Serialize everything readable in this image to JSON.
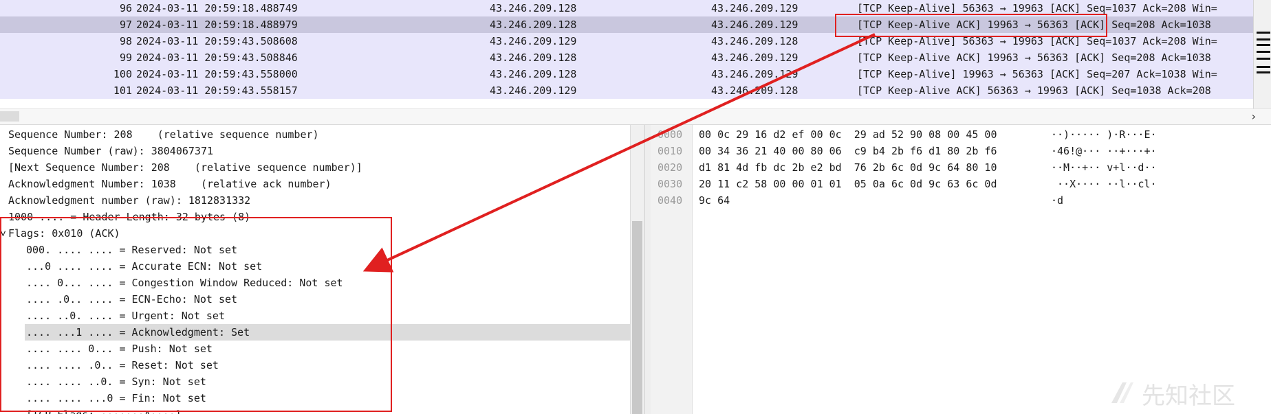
{
  "packet_list": {
    "rows": [
      {
        "no": "96",
        "time": "2024-03-11 20:59:18.488749",
        "src": "43.246.209.128",
        "dst": "43.246.209.129",
        "info": "[TCP Keep-Alive] 56363 → 19963 [ACK] Seq=1037 Ack=208 Win=",
        "selected": false
      },
      {
        "no": "97",
        "time": "2024-03-11 20:59:18.488979",
        "src": "43.246.209.128",
        "dst": "43.246.209.129",
        "info": "[TCP Keep-Alive ACK] 19963 → 56363 [ACK] Seq=208 Ack=1038",
        "selected": true
      },
      {
        "no": "98",
        "time": "2024-03-11 20:59:43.508608",
        "src": "43.246.209.129",
        "dst": "43.246.209.128",
        "info": "[TCP Keep-Alive] 56363 → 19963 [ACK] Seq=1037 Ack=208 Win=",
        "selected": false
      },
      {
        "no": "99",
        "time": "2024-03-11 20:59:43.508846",
        "src": "43.246.209.128",
        "dst": "43.246.209.129",
        "info": "[TCP Keep-Alive ACK] 19963 → 56363 [ACK] Seq=208 Ack=1038",
        "selected": false
      },
      {
        "no": "100",
        "time": "2024-03-11 20:59:43.558000",
        "src": "43.246.209.128",
        "dst": "43.246.209.129",
        "info": "[TCP Keep-Alive] 19963 → 56363 [ACK] Seq=207 Ack=1038 Win=",
        "selected": false
      },
      {
        "no": "101",
        "time": "2024-03-11 20:59:43.558157",
        "src": "43.246.209.129",
        "dst": "43.246.209.128",
        "info": "[TCP Keep-Alive ACK] 56363 → 19963 [ACK] Seq=1038 Ack=208",
        "selected": false
      }
    ],
    "scroll_right_arrow": "›"
  },
  "details": {
    "lines": [
      {
        "indent": 0,
        "text": "Sequence Number: 208    (relative sequence number)"
      },
      {
        "indent": 0,
        "text": "Sequence Number (raw): 3804067371"
      },
      {
        "indent": 0,
        "text": "[Next Sequence Number: 208    (relative sequence number)]"
      },
      {
        "indent": 0,
        "text": "Acknowledgment Number: 1038    (relative ack number)"
      },
      {
        "indent": 0,
        "text": "Acknowledgment number (raw): 1812831332"
      },
      {
        "indent": 0,
        "text": "1000 .... = Header Length: 32 bytes (8)"
      },
      {
        "indent": 0,
        "text": "Flags: 0x010 (ACK)",
        "expander": "˅"
      },
      {
        "indent": 1,
        "text": "000. .... .... = Reserved: Not set"
      },
      {
        "indent": 1,
        "text": "...0 .... .... = Accurate ECN: Not set"
      },
      {
        "indent": 1,
        "text": ".... 0... .... = Congestion Window Reduced: Not set"
      },
      {
        "indent": 1,
        "text": ".... .0.. .... = ECN-Echo: Not set"
      },
      {
        "indent": 1,
        "text": ".... ..0. .... = Urgent: Not set"
      },
      {
        "indent": 1,
        "text": ".... ...1 .... = Acknowledgment: Set",
        "highlight": true
      },
      {
        "indent": 1,
        "text": ".... .... 0... = Push: Not set"
      },
      {
        "indent": 1,
        "text": ".... .... .0.. = Reset: Not set"
      },
      {
        "indent": 1,
        "text": ".... .... ..0. = Syn: Not set"
      },
      {
        "indent": 1,
        "text": ".... .... ...0 = Fin: Not set"
      },
      {
        "indent": 1,
        "text": "[TCP Flags: ·······A····]"
      }
    ]
  },
  "bytes": {
    "rows": [
      {
        "offset": "0000",
        "hex": "00 0c 29 16 d2 ef 00 0c  29 ad 52 90 08 00 45 00",
        "ascii": "··)····· )·R···E·"
      },
      {
        "offset": "0010",
        "hex": "00 34 36 21 40 00 80 06  c9 b4 2b f6 d1 80 2b f6",
        "ascii": "·46!@··· ··+···+·"
      },
      {
        "offset": "0020",
        "hex": "d1 81 4d fb dc 2b e2 bd  76 2b 6c 0d 9c 64 80 10",
        "ascii": "··M··+·· v+l··d··"
      },
      {
        "offset": "0030",
        "hex": "20 11 c2 58 00 00 01 01  05 0a 6c 0d 9c 63 6c 0d",
        "ascii": " ··X···· ··l··cl·"
      },
      {
        "offset": "0040",
        "hex": "9c 64",
        "ascii": "·d"
      }
    ]
  },
  "watermark": {
    "text": "先知社区",
    "icon": "xianzhi-logo-icon"
  },
  "colors": {
    "annotation": "#e02020",
    "list_bg": "#e8e6fb",
    "selected_bg": "#c9c7de"
  }
}
